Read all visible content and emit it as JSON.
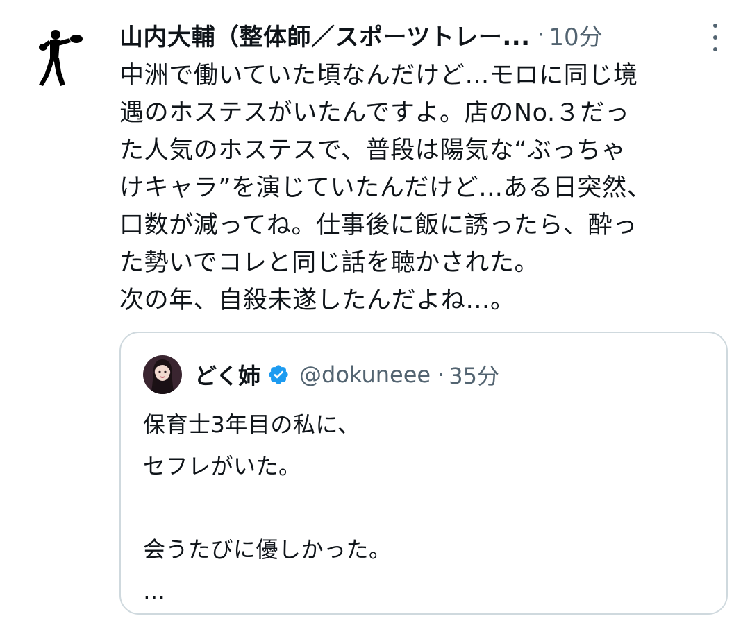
{
  "post": {
    "author_name": "山内大輔（整体師／スポーツトレー...",
    "separator": "·",
    "time": "10分",
    "avatar_icon": "boxer-silhouette-icon",
    "more_icon": "more-vertical-icon",
    "body_lines": [
      "中洲で働いていた頃なんだけど…モロに同じ境",
      "遇のホステスがいたんですよ。店のNo.３だっ",
      "た人気のホステスで、普段は陽気な“ぶっちゃ",
      "けキャラ”を演じていたんだけど…ある日突然、",
      "口数が減ってね。仕事後に飯に誘ったら、酔っ",
      "た勢いでコレと同じ話を聴かされた。",
      "次の年、自殺未遂したんだよね…。"
    ]
  },
  "quote": {
    "author_name": "どく姉",
    "handle": "@dokuneee",
    "separator": "·",
    "time": "35分",
    "verified_icon": "verified-badge-icon",
    "verified_color": "#1d9bf0",
    "body_lines": [
      "保育士3年目の私に、",
      "セフレがいた。",
      "",
      "会うたびに優しかった。",
      "…"
    ]
  },
  "colors": {
    "text_primary": "#0f1419",
    "text_secondary": "#536471",
    "border": "#cfd9de"
  }
}
